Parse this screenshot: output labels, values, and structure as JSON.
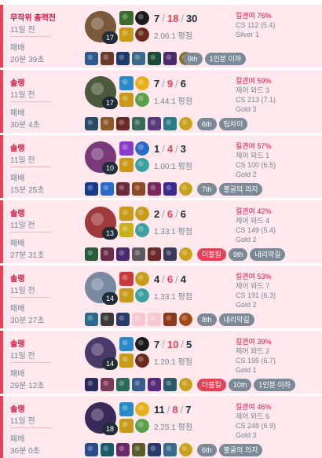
{
  "matches": [
    {
      "mode": "무작위 총력전",
      "ago": "11일 전",
      "result": "패배",
      "duration": "20분 39초",
      "level": "17",
      "kills": "7",
      "deaths": "18",
      "assists": "30",
      "ratio": "2.06:1 평점",
      "kp": "킬관여 76%",
      "line2": "CS 112 (5.4)",
      "line3": "Silver 1",
      "line4": "",
      "tags": [
        {
          "label": "9th",
          "style": "place"
        },
        {
          "label": "1인분 이하",
          "style": "dark"
        }
      ],
      "champ_color": "#7a5a3a",
      "spell1_color": "#3b6b2e",
      "spell2_color": "#c89a18",
      "rune1_color": "#1a1a1a",
      "rune2_color": "#6b2a1e",
      "items": [
        "#2f5a8a",
        "#6a3a2a",
        "#1e3a6a",
        "#3a6a8a",
        "#1b4a3a",
        "#4a2a6a",
        "#8a6a2a"
      ]
    },
    {
      "mode": "솔랭",
      "ago": "11일 전",
      "result": "패배",
      "duration": "30분 4초",
      "level": "17",
      "kills": "7",
      "deaths": "9",
      "assists": "6",
      "ratio": "1.44:1 평점",
      "kp": "킬관여 59%",
      "line2": "제어 와드 3",
      "line3": "CS 213 (7.1)",
      "line4": "Gold 3",
      "tags": [
        {
          "label": "6th",
          "style": "place"
        },
        {
          "label": "팀차이",
          "style": "dark"
        }
      ],
      "champ_color": "#4a5a3a",
      "spell1_color": "#2a8ac8",
      "spell2_color": "#c89a18",
      "rune1_color": "#e6b01a",
      "rune2_color": "#5aa04a",
      "items": [
        "#2a4a6a",
        "#8a5a2a",
        "#6a2a2a",
        "#3a6a5a",
        "#5a3a7a",
        "#2a7a8a",
        "#c8a01a"
      ]
    },
    {
      "mode": "솔랭",
      "ago": "11일 전",
      "result": "패배",
      "duration": "15분 25초",
      "level": "10",
      "kills": "1",
      "deaths": "4",
      "assists": "3",
      "ratio": "1.00:1 평점",
      "kp": "킬관여 57%",
      "line2": "제어 와드 1",
      "line3": "CS 100 (6.5)",
      "line4": "Gold 2",
      "tags": [
        {
          "label": "7th",
          "style": "place"
        },
        {
          "label": "불굴의 의지",
          "style": "dark"
        }
      ],
      "champ_color": "#7a3a7a",
      "spell1_color": "#8a3ac8",
      "spell2_color": "#c89a18",
      "rune1_color": "#2a6ac8",
      "rune2_color": "#3aa0a0",
      "items": [
        "#1a3a8a",
        "#2a6ac8",
        "#6a2a3a",
        "#8a4a2a",
        "#7a2a5a",
        "#3a2a8a",
        "#c8a01a"
      ]
    },
    {
      "mode": "솔랭",
      "ago": "11일 전",
      "result": "패배",
      "duration": "27분 31초",
      "level": "13",
      "kills": "2",
      "deaths": "6",
      "assists": "6",
      "ratio": "1.33:1 평점",
      "kp": "킬관여 42%",
      "line2": "제어 와드 4",
      "line3": "CS 149 (5.4)",
      "line4": "Gold 2",
      "tags": [
        {
          "label": "더블킬",
          "style": "red"
        },
        {
          "label": "9th",
          "style": "place"
        },
        {
          "label": "내리막길",
          "style": "dark"
        }
      ],
      "champ_color": "#a03a3a",
      "spell1_color": "#c89a18",
      "spell2_color": "#c8b01a",
      "rune1_color": "#c89a18",
      "rune2_color": "#3aa0a0",
      "items": [
        "#2a5a3a",
        "#6a2a4a",
        "#4a2a6a",
        "#5a5a5a",
        "#6a2a2a",
        "#3a3a5a",
        "#c8a01a"
      ]
    },
    {
      "mode": "솔랭",
      "ago": "11일 전",
      "result": "패배",
      "duration": "30분 27초",
      "level": "14",
      "kills": "4",
      "deaths": "6",
      "assists": "4",
      "ratio": "1.33:1 평점",
      "kp": "킬관여 53%",
      "line2": "제어 와드 7",
      "line3": "CS 191 (6.3)",
      "line4": "Gold 2",
      "tags": [
        {
          "label": "8th",
          "style": "place"
        },
        {
          "label": "내리막길",
          "style": "dark"
        }
      ],
      "champ_color": "#7a8aa0",
      "spell1_color": "#c83a3a",
      "spell2_color": "#c89a18",
      "rune1_color": "#c89a18",
      "rune2_color": "#3aa0a0",
      "items": [
        "#2a6a8a",
        "#3a3a3a",
        "#2a3a6a",
        "#f8c8d0",
        "#f8c8d0",
        "#8a3a1a",
        "#a04a1a"
      ]
    },
    {
      "mode": "솔랭",
      "ago": "11일 전",
      "result": "패배",
      "duration": "29분 12초",
      "level": "14",
      "kills": "7",
      "deaths": "10",
      "assists": "5",
      "ratio": "1.20:1 평점",
      "kp": "킬관여 39%",
      "line2": "제어 와드 2",
      "line3": "CS 195 (6.7)",
      "line4": "Gold 1",
      "tags": [
        {
          "label": "더블킬",
          "style": "red"
        },
        {
          "label": "10th",
          "style": "place"
        },
        {
          "label": "1인분 이하",
          "style": "dark"
        }
      ],
      "champ_color": "#4a3a6a",
      "spell1_color": "#2a8ac8",
      "spell2_color": "#c89a18",
      "rune1_color": "#1a1a1a",
      "rune2_color": "#6b2a1e",
      "items": [
        "#2a2a5a",
        "#7a3a5a",
        "#2a6a5a",
        "#3a5a8a",
        "#5a2a7a",
        "#2a5a6a",
        "#c8a01a"
      ]
    },
    {
      "mode": "솔랭",
      "ago": "11일 전",
      "result": "패배",
      "duration": "36분 0초",
      "level": "18",
      "kills": "11",
      "deaths": "8",
      "assists": "7",
      "ratio": "2.25:1 평점",
      "kp": "킬관여 46%",
      "line2": "제어 와드 6",
      "line3": "CS 248 (6.9)",
      "line4": "Gold 3",
      "tags": [
        {
          "label": "6th",
          "style": "place"
        },
        {
          "label": "불굴의 의지",
          "style": "dark"
        }
      ],
      "champ_color": "#3a2a5a",
      "spell1_color": "#2a8ac8",
      "spell2_color": "#c89a18",
      "rune1_color": "#e6b01a",
      "rune2_color": "#5aa04a",
      "items": [
        "#2a4a8a",
        "#1a5a6a",
        "#6a2a6a",
        "#5a5a2a",
        "#2a3a6a",
        "#3a6a8a",
        "#c8a01a"
      ]
    }
  ]
}
